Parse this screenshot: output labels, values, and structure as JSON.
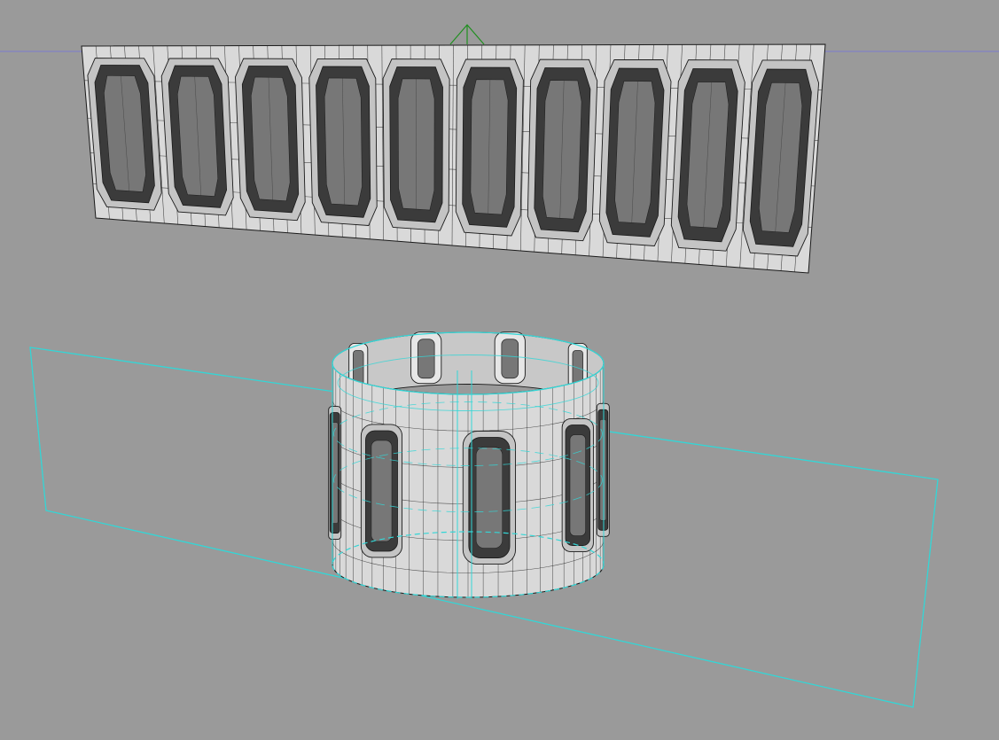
{
  "viewport": {
    "view": "perspective",
    "background": "#9a9a9a"
  },
  "colors": {
    "mesh_face": "#d9d9d9",
    "mesh_edge": "#1a1a1a",
    "slot_dark": "#3b3b3b",
    "slot_mid": "#777777",
    "selection": "#33d6d6",
    "horizon_line": "#7c7cd0",
    "axis_gizmo": "#1f8f1f"
  },
  "objects": [
    {
      "name": "flat-slotted-panel",
      "kind": "plane",
      "slot_count": 10
    },
    {
      "name": "slotted-cylinder",
      "kind": "cylinder",
      "selected": true
    }
  ]
}
